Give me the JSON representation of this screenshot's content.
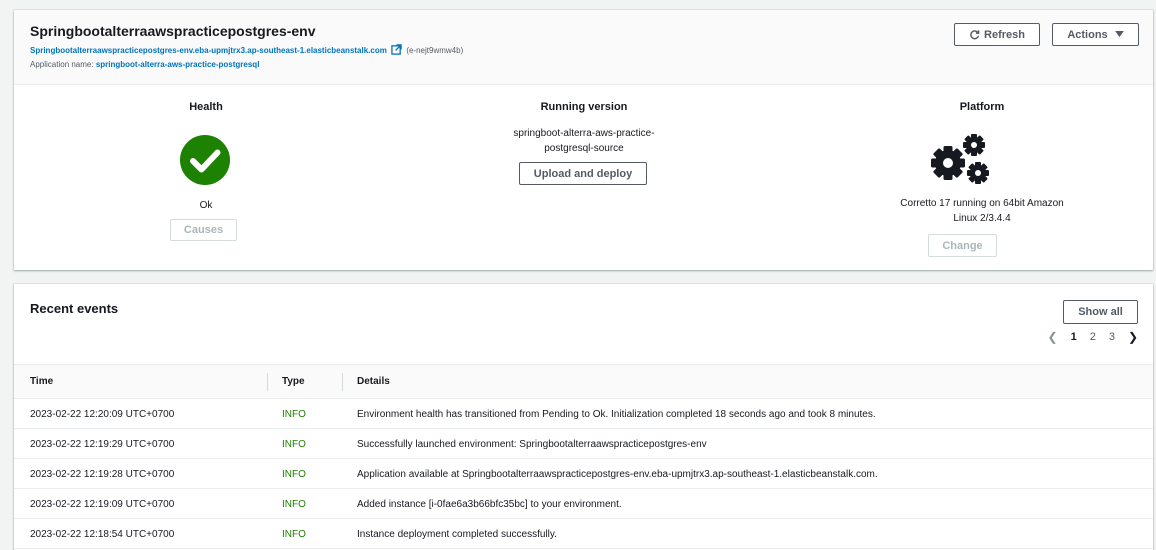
{
  "environment": {
    "name": "Springbootalterraawspracticepostgres-env",
    "url": "Springbootalterraawspracticepostgres-env.eba-upmjtrx3.ap-southeast-1.elasticbeanstalk.com",
    "env_id": "(e-nejt9wmw4b)",
    "app_label": "Application name:",
    "app_name": "springboot-alterra-aws-practice-postgresql",
    "refresh_label": "Refresh",
    "actions_label": "Actions"
  },
  "health": {
    "title": "Health",
    "status": "Ok",
    "causes_label": "Causes",
    "color": "#1d8102"
  },
  "running_version": {
    "title": "Running version",
    "version": "springboot-alterra-aws-practice-postgresql-source",
    "upload_label": "Upload and deploy"
  },
  "platform": {
    "title": "Platform",
    "description": "Corretto 17 running on 64bit Amazon Linux 2/3.4.4",
    "change_label": "Change",
    "icon": "gears-icon"
  },
  "recent_events": {
    "title": "Recent events",
    "show_all_label": "Show all",
    "pagination": {
      "pages": [
        "1",
        "2",
        "3"
      ],
      "current": "1"
    },
    "columns": [
      "Time",
      "Type",
      "Details"
    ],
    "rows": [
      {
        "time": "2023-02-22 12:20:09 UTC+0700",
        "type": "INFO",
        "details": "Environment health has transitioned from Pending to Ok. Initialization completed 18 seconds ago and took 8 minutes."
      },
      {
        "time": "2023-02-22 12:19:29 UTC+0700",
        "type": "INFO",
        "details": "Successfully launched environment: Springbootalterraawspracticepostgres-env"
      },
      {
        "time": "2023-02-22 12:19:28 UTC+0700",
        "type": "INFO",
        "details": "Application available at Springbootalterraawspracticepostgres-env.eba-upmjtrx3.ap-southeast-1.elasticbeanstalk.com."
      },
      {
        "time": "2023-02-22 12:19:09 UTC+0700",
        "type": "INFO",
        "details": "Added instance [i-0fae6a3b66bfc35bc] to your environment."
      },
      {
        "time": "2023-02-22 12:18:54 UTC+0700",
        "type": "INFO",
        "details": "Instance deployment completed successfully."
      }
    ]
  }
}
